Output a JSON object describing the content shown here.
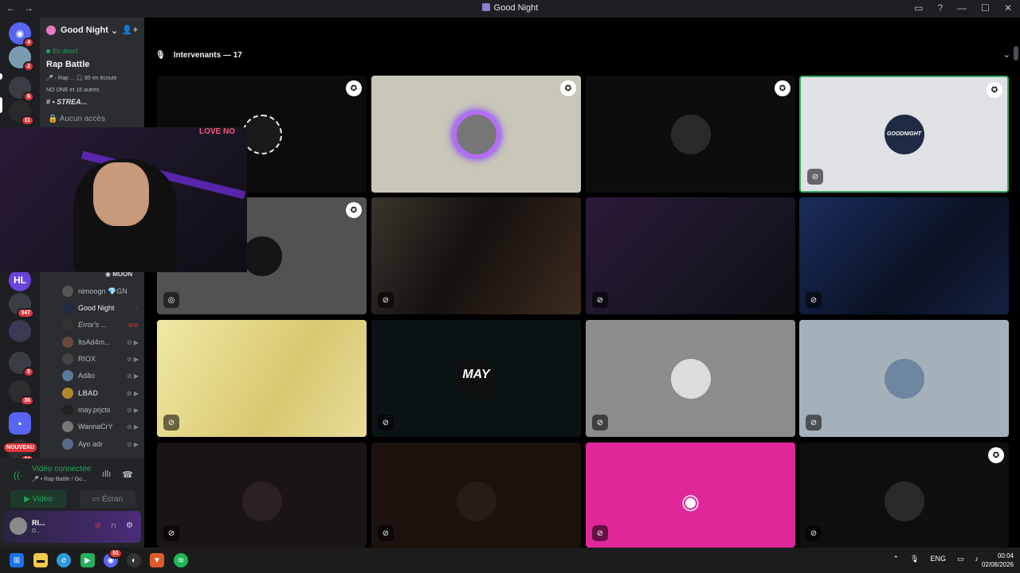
{
  "window": {
    "title": "Good Night",
    "back": "←",
    "forward": "→",
    "controls": [
      "▭",
      "?",
      "—",
      "☐",
      "✕"
    ]
  },
  "guilds": [
    {
      "badge": "4"
    },
    {
      "badge": "2"
    },
    {
      "badge": "6"
    },
    {
      "badge": "11"
    },
    {
      "badge": "347"
    },
    {
      "badge": "5"
    },
    {
      "badge": "36"
    },
    {
      "badge": "24"
    }
  ],
  "nouveau": "NOUVEAU",
  "server": {
    "name": "Good Night",
    "live_label": "En direct",
    "stage_name": "Rap Battle",
    "stage_info1": "🎤 - Rap ...   🎧 85 en écoute",
    "stage_info2": "NO ONE et 16 autres",
    "stream_channel": "#  • STREA...",
    "no_access": "Aucun accès"
  },
  "moon_label": "MOON",
  "members": [
    {
      "name": "nimoogn 💎GN"
    },
    {
      "name": "Good Night"
    },
    {
      "name": "Error's ..."
    },
    {
      "name": "ItsAd4m..."
    },
    {
      "name": "RIOX"
    },
    {
      "name": "Adão"
    },
    {
      "name": "LBAD"
    },
    {
      "name": "may.prjcts"
    },
    {
      "name": "WannaCrY"
    },
    {
      "name": "Ayo adr"
    }
  ],
  "voice": {
    "connected": "Vidéo connectée",
    "channel": "🎤 • Rap Battle / Go...",
    "video_btn": "Vidéo",
    "screen_btn": "Écran"
  },
  "user": {
    "name": "RI...",
    "status": "D..."
  },
  "stage": {
    "speakers": "Intervenants — 17"
  },
  "tiles": [
    {
      "bg": "#0b0b0b"
    },
    {
      "bg": "#c9c7b8"
    },
    {
      "bg": "#0d0d0d"
    },
    {
      "bg": "#dfe1e5"
    },
    {
      "bg": "#525252"
    },
    {
      "bg": "#1a1512"
    },
    {
      "bg": "#1f1a2a"
    },
    {
      "bg": "#0f1830"
    },
    {
      "bg": "#eee29e"
    },
    {
      "bg": "#0b1314"
    },
    {
      "bg": "#8c8c8c"
    },
    {
      "bg": "#a4b1ba"
    },
    {
      "bg": "#1a1419"
    },
    {
      "bg": "#1c130e"
    },
    {
      "bg": "#e0279a"
    },
    {
      "bg": "#0f0f0f"
    }
  ],
  "tile_texts": {
    "goodnight": "GOODNIGHT",
    "may": "MAY"
  },
  "pip": {
    "sign": "LOVE NO"
  },
  "taskbar": {
    "lang": "ENG",
    "time": "00:04",
    "date": "02/08/2026",
    "badge": "51"
  }
}
